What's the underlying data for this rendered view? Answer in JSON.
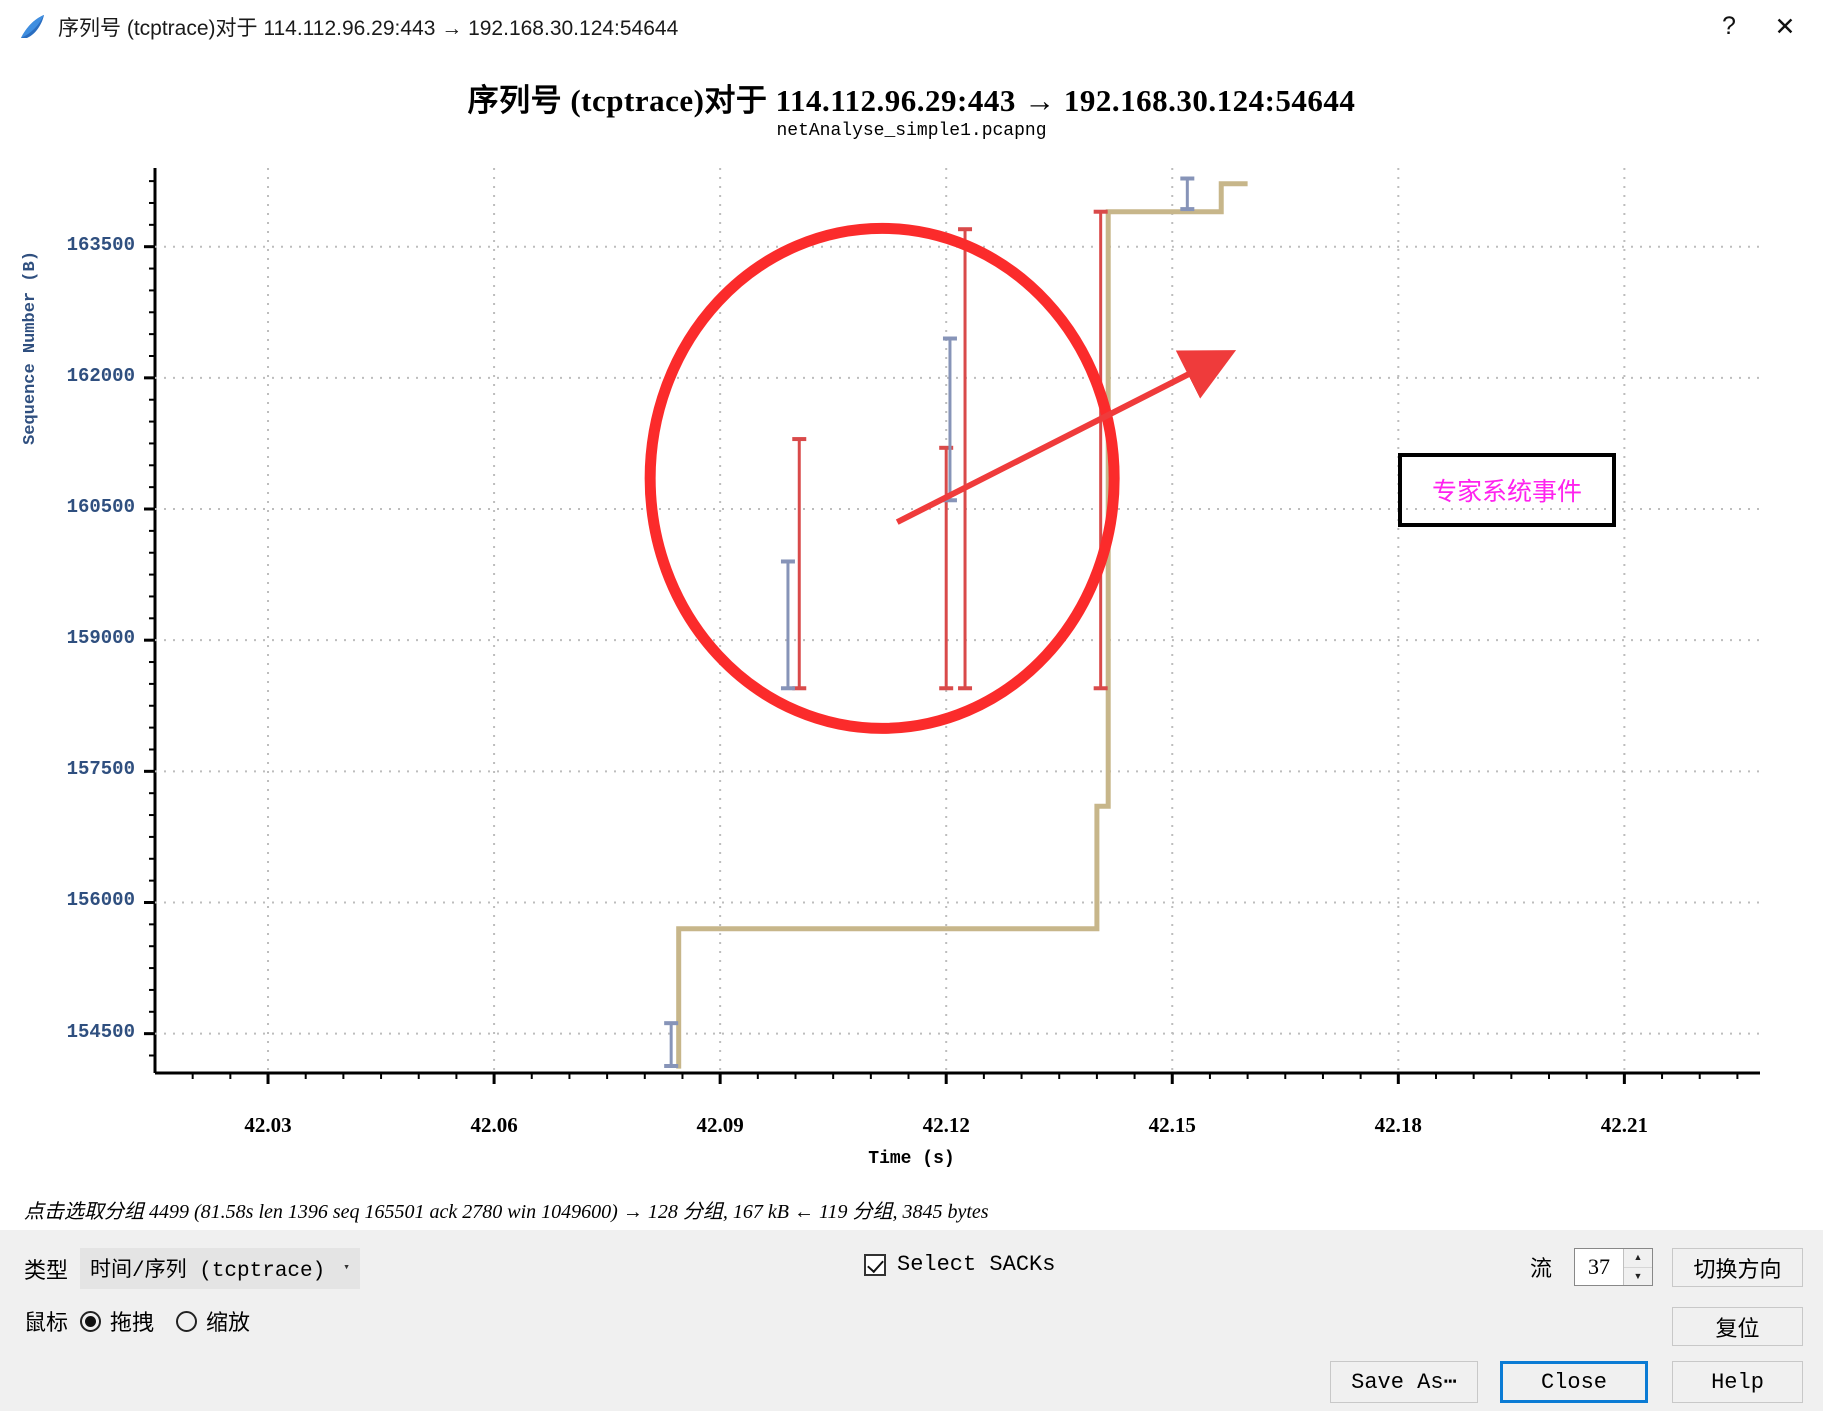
{
  "window": {
    "title": "序列号 (tcptrace)对于 114.112.96.29:443 → 192.168.30.124:54644",
    "help_icon": "?",
    "close_icon": "✕",
    "app_icon": "wireshark-fin-icon"
  },
  "chart_data": {
    "type": "line",
    "title": "序列号 (tcptrace)对于 114.112.96.29:443 → 192.168.30.124:54644",
    "subtitle": "netAnalyse_simple1.pcapng",
    "xlabel": "Time (s)",
    "ylabel": "Sequence Number (B)",
    "xlim": [
      42.015,
      42.228
    ],
    "ylim": [
      154050,
      164400
    ],
    "grid": true,
    "xticks": [
      "42.03",
      "42.06",
      "42.09",
      "42.12",
      "42.15",
      "42.18",
      "42.21"
    ],
    "xtick_values": [
      42.03,
      42.06,
      42.09,
      42.12,
      42.15,
      42.18,
      42.21
    ],
    "yticks": [
      "163500",
      "162000",
      "160500",
      "159000",
      "157500",
      "156000",
      "154500"
    ],
    "ytick_values": [
      163500,
      162000,
      160500,
      159000,
      157500,
      156000,
      154500
    ],
    "colors": {
      "ack_line": "#c7b68a",
      "segment": "#d94a4a",
      "sack": "#8794b8",
      "tick": "#2f4f7f",
      "annotation": "#ff22ee",
      "highlight_circle": "#fb2b2b"
    },
    "series": [
      {
        "name": "ack-step-line",
        "type": "step",
        "color": "#c7b68a",
        "points": [
          [
            42.0845,
            154100
          ],
          [
            42.0845,
            155700
          ],
          [
            42.14,
            155700
          ],
          [
            42.14,
            157100
          ],
          [
            42.1415,
            157100
          ],
          [
            42.1415,
            163900
          ],
          [
            42.1565,
            163900
          ],
          [
            42.1565,
            164220
          ],
          [
            42.16,
            164220
          ]
        ]
      },
      {
        "name": "tcp-segment-bars",
        "type": "vline",
        "color": "#d94a4a",
        "bars": [
          {
            "x": 42.1005,
            "y0": 158450,
            "y1": 161300
          },
          {
            "x": 42.12,
            "y0": 158450,
            "y1": 161200
          },
          {
            "x": 42.1225,
            "y0": 158450,
            "y1": 163700
          },
          {
            "x": 42.1405,
            "y0": 158450,
            "y1": 163900
          }
        ]
      },
      {
        "name": "sack-bars",
        "type": "vline",
        "color": "#8794b8",
        "bars": [
          {
            "x": 42.099,
            "y0": 158450,
            "y1": 159900
          },
          {
            "x": 42.1205,
            "y0": 160600,
            "y1": 162450
          },
          {
            "x": 42.152,
            "y0": 163930,
            "y1": 164280
          },
          {
            "x": 42.0835,
            "y0": 154130,
            "y1": 154620
          }
        ]
      }
    ],
    "annotations": [
      {
        "name": "expert-event-highlight",
        "shape": "ellipse",
        "cx": 42.1115,
        "cy": 160850,
        "color": "#fb2b2b"
      },
      {
        "name": "expert-event-arrow",
        "shape": "arrow",
        "color": "#ef3b3b",
        "from": [
          42.1135,
          160350
        ],
        "to": [
          42.1535,
          162100
        ]
      },
      {
        "name": "expert-event-label",
        "shape": "box-label",
        "text": "专家系统事件",
        "text_color": "#ff22ee",
        "border_color": "#000000"
      }
    ]
  },
  "status": {
    "text": "点击选取分组 4499 (81.58s len 1396 seq 165501 ack 2780 win 1049600) → 128 分组, 167 kB ← 119 分组, 3845 bytes"
  },
  "controls": {
    "type_label": "类型",
    "graph_type_value": "时间/序列 (tcptrace)",
    "graph_type_arrow": "▾",
    "mouse_label": "鼠标",
    "mouse_options": [
      {
        "label": "拖拽",
        "checked": true
      },
      {
        "label": "缩放",
        "checked": false
      }
    ],
    "select_sacks_label": "Select SACKs",
    "select_sacks_checked": true,
    "stream_label": "流",
    "stream_value": "37",
    "spin_up": "▲",
    "spin_down": "▼",
    "switch_direction_label": "切换方向",
    "reset_label": "复位",
    "save_as_label": "Save As⋯",
    "close_label": "Close",
    "help_label": "Help"
  }
}
